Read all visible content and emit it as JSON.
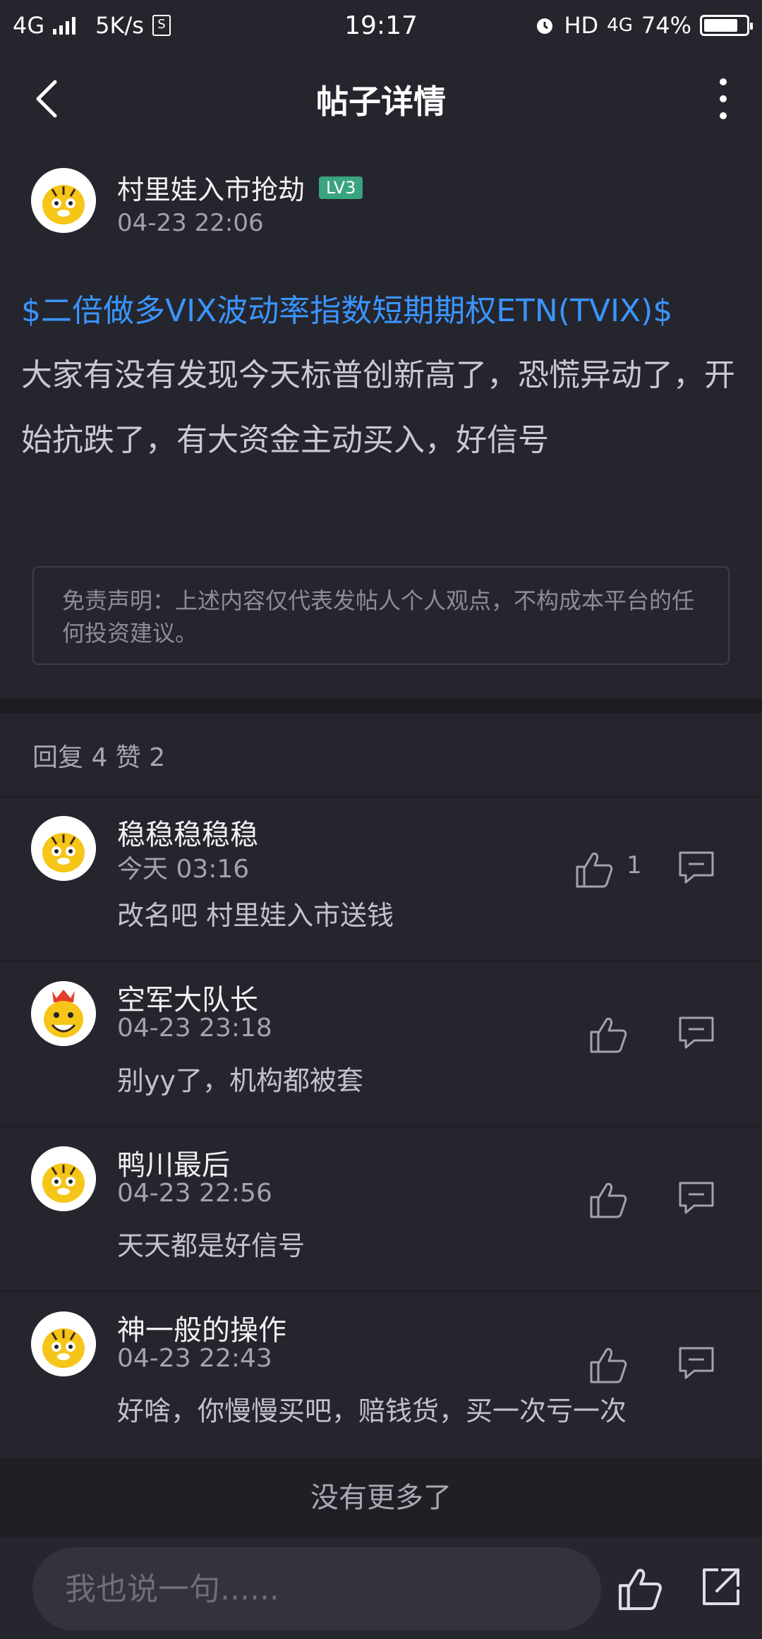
{
  "status_bar": {
    "network": "4G",
    "speed": "5K/s",
    "time": "19:17",
    "hd": "HD",
    "network2": "4G",
    "battery": "74%",
    "battery_level": 0.74
  },
  "nav": {
    "title": "帖子详情"
  },
  "post": {
    "author": "村里娃入市抢劫",
    "level": "LV3",
    "time": "04-23 22:06",
    "stock_tag": "$二倍做多VIX波动率指数短期期权ETN(TVIX)$",
    "text": "大家有没有发现今天标普创新高了，恐慌异动了，开始抗跌了，有大资金主动买入，好信号",
    "disclaimer": "免责声明：上述内容仅代表发帖人个人观点，不构成本平台的任何投资建议。"
  },
  "summary": {
    "text": "回复 4 赞 2"
  },
  "comments": [
    {
      "name": "稳稳稳稳稳",
      "time": "今天 03:16",
      "text": "改名吧 村里娃入市送钱",
      "likes": "1",
      "avatar": "tiger-avatar"
    },
    {
      "name": "空军大队长",
      "time": "04-23 23:18",
      "text": "别yy了，机构都被套",
      "likes": "",
      "avatar": "crowned-tiger-avatar"
    },
    {
      "name": "鸭川最后",
      "time": "04-23 22:56",
      "text": "天天都是好信号",
      "likes": "",
      "avatar": "tiger-avatar"
    },
    {
      "name": "神一般的操作",
      "time": "04-23 22:43",
      "text": "好啥，你慢慢买吧，赔钱货，买一次亏一次",
      "likes": "",
      "avatar": "tiger-avatar"
    }
  ],
  "footer": {
    "no_more": "没有更多了",
    "input_placeholder": "我也说一句......"
  },
  "colors": {
    "background": "#25252d",
    "stock_link": "#3a95ff",
    "level_badge": "#3aa37f"
  },
  "icons": {
    "back": "back-arrow-icon",
    "more": "more-vertical-icon",
    "like": "thumbs-up-icon",
    "reply": "comment-icon",
    "share": "share-icon"
  }
}
